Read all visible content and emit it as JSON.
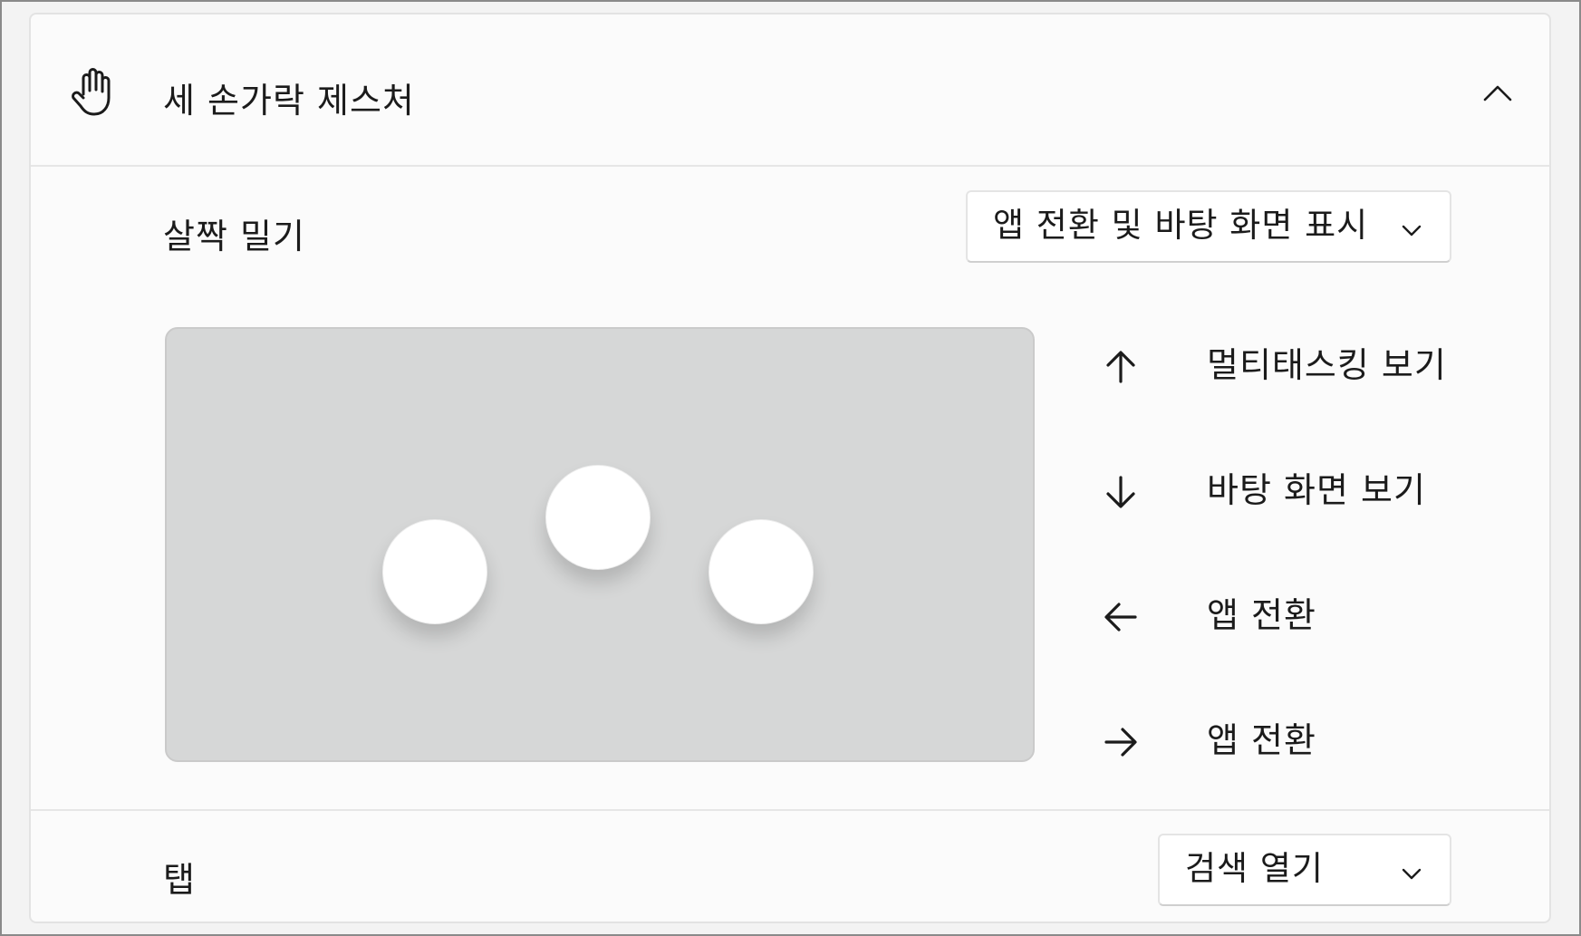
{
  "section": {
    "title": "세 손가락 제스처",
    "icon": "hand-icon",
    "expanded": true
  },
  "swipe": {
    "label": "살짝 밀기",
    "selected": "앱 전환 및 바탕 화면 표시"
  },
  "gestures": [
    {
      "direction": "up",
      "icon": "arrow-up-icon",
      "label": "멀티태스킹 보기"
    },
    {
      "direction": "down",
      "icon": "arrow-down-icon",
      "label": "바탕 화면 보기"
    },
    {
      "direction": "left",
      "icon": "arrow-left-icon",
      "label": "앱 전환"
    },
    {
      "direction": "right",
      "icon": "arrow-right-icon",
      "label": "앱 전환"
    }
  ],
  "tap": {
    "label": "탭",
    "selected": "검색 열기"
  }
}
